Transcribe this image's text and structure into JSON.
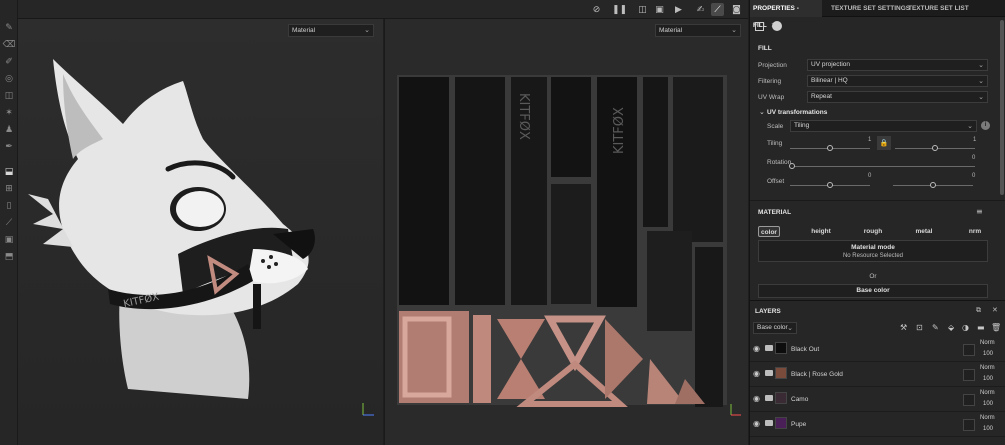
{
  "toolbar": {
    "icons": [
      "no-symmetry-icon",
      "pause-icon",
      "split-view-icon",
      "cube-view-icon",
      "camera-icon",
      "paint-icon",
      "brush-icon",
      "screenshot-icon"
    ]
  },
  "viewport3d": {
    "mode": "Material",
    "chev": "⌄",
    "axis_y": "Y",
    "axis_x": "Z"
  },
  "viewport2d": {
    "mode": "Material",
    "chev": "⌄",
    "axis_y": "Y",
    "axis_x": "X"
  },
  "tabs": [
    {
      "label": "PROPERTIES - FILL",
      "close": "✕"
    },
    {
      "label": "TEXTURE SET SETTINGS"
    },
    {
      "label": "TEXTURE SET LIST"
    }
  ],
  "fill": {
    "title": "FILL",
    "projection_label": "Projection",
    "projection_value": "UV projection",
    "filtering_label": "Filtering",
    "filtering_value": "Bilinear | HQ",
    "uvwrap_label": "UV Wrap",
    "uvwrap_value": "Repeat",
    "uvtransform_title": "UV transformations",
    "scale_label": "Scale",
    "scale_value": "Tiling",
    "tiling_label": "Tiling",
    "tiling_value_1": "1",
    "tiling_value_2": "1",
    "tiling_fraction": 0.5,
    "rotation_label": "Rotation",
    "rotation_value": "0",
    "rotation_fraction": 0.0,
    "offset_label": "Offset",
    "offset_value_1": "0",
    "offset_value_2": "0",
    "offset_fraction": 0.5
  },
  "material": {
    "title": "MATERIAL",
    "channels": [
      "color",
      "height",
      "rough",
      "metal",
      "nrm"
    ],
    "active_channel": "color",
    "model_title": "Material mode",
    "model_value": "No Resource Selected",
    "or_label": "Or",
    "base_color_label": "Base color"
  },
  "layers": {
    "title": "LAYERS",
    "channel_select": "Base color",
    "items": [
      {
        "name": "Black Out",
        "blend": "Norm",
        "opacity": "100",
        "thumb_color": "#0d0d0d"
      },
      {
        "name": "Black | Rose Gold",
        "blend": "Norm",
        "opacity": "100",
        "thumb_color": "#7a4a3a"
      },
      {
        "name": "Camo",
        "blend": "Norm",
        "opacity": "100",
        "thumb_color": "#3a2a34"
      },
      {
        "name": "Pupe",
        "blend": "Norm",
        "opacity": "100",
        "thumb_color": "#4a1e56"
      }
    ]
  },
  "colors": {
    "accent_active_tab": "#2e2e2e",
    "rose_gold": "#c28b80",
    "panel_bg": "#262626"
  }
}
